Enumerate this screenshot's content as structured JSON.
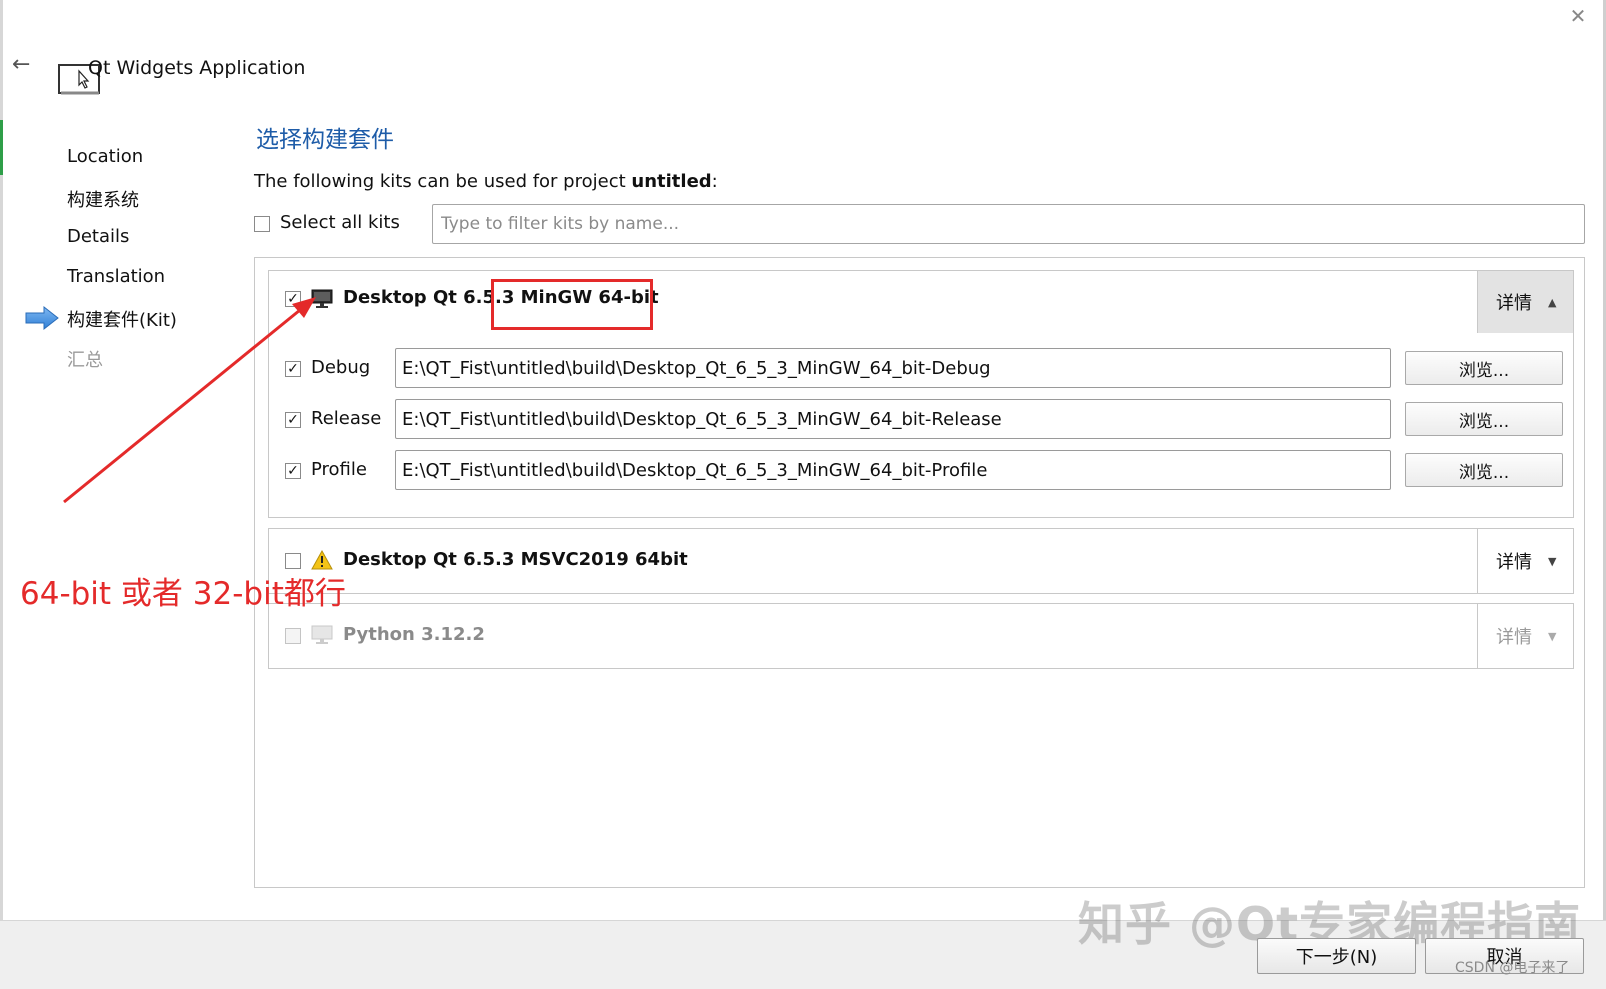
{
  "window": {
    "title": "Qt Widgets Application",
    "back_icon": "arrow-left-icon",
    "close_icon": "close-icon"
  },
  "sidebar": {
    "items": [
      {
        "label": "Location",
        "state": "done"
      },
      {
        "label": "构建系统",
        "state": "done"
      },
      {
        "label": "Details",
        "state": "done"
      },
      {
        "label": "Translation",
        "state": "done"
      },
      {
        "label": "构建套件(Kit)",
        "state": "current"
      },
      {
        "label": "汇总",
        "state": "pending"
      }
    ]
  },
  "page": {
    "heading": "选择构建套件",
    "intro_prefix": "The following kits can be used for project ",
    "project_name": "untitled",
    "intro_suffix": ":",
    "select_all_label": "Select all kits",
    "select_all_checked": false,
    "filter_placeholder": "Type to filter kits by name..."
  },
  "kits": [
    {
      "name": "Desktop Qt 6.5.3 MinGW 64-bit",
      "checked": true,
      "icon": "monitor-icon",
      "details_label": "详情",
      "expanded": true,
      "build_configs": [
        {
          "label": "Debug",
          "checked": true,
          "path": "E:\\QT_Fist\\untitled\\build\\Desktop_Qt_6_5_3_MinGW_64_bit-Debug",
          "browse_label": "浏览..."
        },
        {
          "label": "Release",
          "checked": true,
          "path": "E:\\QT_Fist\\untitled\\build\\Desktop_Qt_6_5_3_MinGW_64_bit-Release",
          "browse_label": "浏览..."
        },
        {
          "label": "Profile",
          "checked": true,
          "path": "E:\\QT_Fist\\untitled\\build\\Desktop_Qt_6_5_3_MinGW_64_bit-Profile",
          "browse_label": "浏览..."
        }
      ]
    },
    {
      "name": "Desktop Qt 6.5.3 MSVC2019 64bit",
      "checked": false,
      "icon": "warning-icon",
      "details_label": "详情",
      "expanded": false
    },
    {
      "name": "Python 3.12.2",
      "checked": false,
      "icon": "monitor-icon",
      "details_label": "详情",
      "expanded": false,
      "disabled": true
    }
  ],
  "footer": {
    "next_label": "下一步(N)",
    "cancel_label": "取消"
  },
  "annotation": {
    "text": "64-bit 或者 32-bit都行",
    "color": "#e42a2a"
  },
  "watermarks": {
    "zhihu": "知乎 @Qt专家编程指南",
    "csdn": "CSDN @电子来了"
  },
  "colors": {
    "heading": "#1e5ca8",
    "annotation_red": "#e42a2a",
    "nav_arrow": "#3a8ee6"
  }
}
